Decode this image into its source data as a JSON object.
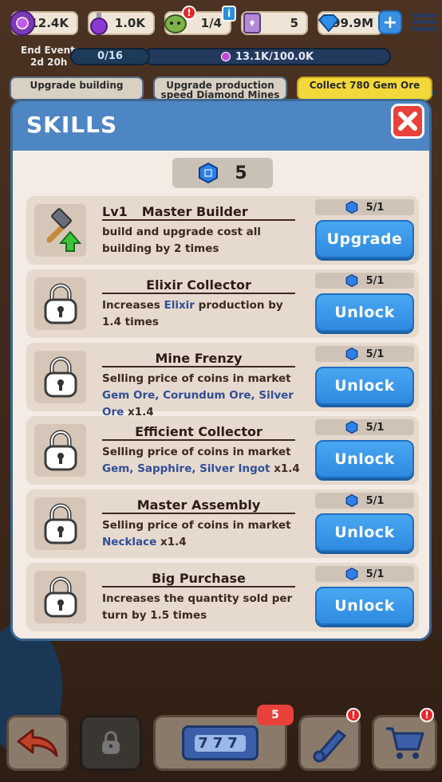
{
  "hud": {
    "elixir": "12.4K",
    "potion": "1.0K",
    "goblins": "1/4",
    "tickets": "5",
    "gems": "99.9M",
    "alert_mark": "!",
    "info_mark": "i",
    "plus": "+"
  },
  "event": {
    "label_line1": "End Event:",
    "label_line2": "2d 20h",
    "progress_small": "0/16",
    "progress_big": "13.1K/100.0K"
  },
  "tasks": [
    {
      "label": "Upgrade building"
    },
    {
      "label": "Upgrade production speed Diamond Mines to"
    },
    {
      "label": "Collect 780 Gem Ore"
    }
  ],
  "modal": {
    "title": "SKILLS",
    "gem_balance": "5"
  },
  "skills": [
    {
      "level": "Lv1",
      "name": "Master Builder",
      "desc_plain1": "build and upgrade cost all building by 2 times",
      "cost": "5/1",
      "button": "Upgrade",
      "locked": false
    },
    {
      "name": "Elixir Collector",
      "desc_plain1": "Increases ",
      "desc_hl1": "Elixir",
      "desc_plain2": "  production by 1.4 times",
      "cost": "5/1",
      "button": "Unlock",
      "locked": true
    },
    {
      "name": "Mine Frenzy",
      "desc_plain1": "Selling price of coins in market ",
      "desc_hl1": "Gem Ore, Corundum Ore, Silver Ore",
      "desc_plain2": " x1.4",
      "cost": "5/1",
      "button": "Unlock",
      "locked": true
    },
    {
      "name": "Efficient Collector",
      "desc_plain1": "Selling price of coins in market ",
      "desc_hl1": "Gem, Sapphire, Silver Ingot",
      "desc_plain2": " x1.4",
      "cost": "5/1",
      "button": "Unlock",
      "locked": true
    },
    {
      "name": "Master Assembly",
      "desc_plain1": "Selling price of coins in market ",
      "desc_hl1": "Necklace",
      "desc_plain2": " x1.4",
      "cost": "5/1",
      "button": "Unlock",
      "locked": true
    },
    {
      "name": "Big Purchase",
      "desc_plain1": "Increases the quantity sold per turn by 1.5 times",
      "cost": "5/1",
      "button": "Unlock",
      "locked": true
    }
  ],
  "bottom": {
    "slot_badge": "5",
    "slot_reels": "777",
    "alert_mark": "!"
  },
  "colors": {
    "accent_blue": "#4e86c3",
    "button_blue": "#3a97e8",
    "close_red": "#e8413a",
    "highlight_text": "#2f4f97"
  }
}
